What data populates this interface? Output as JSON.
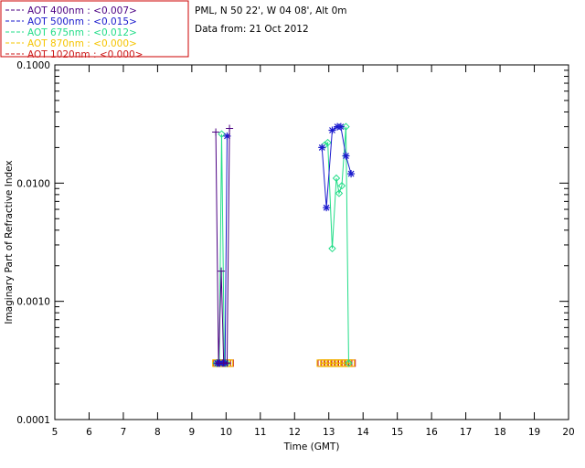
{
  "chart_data": {
    "type": "line",
    "site_label": "PML, N 50 22', W 04 08', Alt 0m",
    "date_label": "Data from: 21 Oct 2012",
    "xlabel": "Time (GMT)",
    "ylabel": "Imaginary Part of Refractive Index",
    "xlim": [
      5,
      20
    ],
    "ylim": [
      0.0001,
      0.1
    ],
    "yscale": "log",
    "x_ticks": [
      "5",
      "6",
      "7",
      "8",
      "9",
      "10",
      "11",
      "12",
      "13",
      "14",
      "15",
      "16",
      "17",
      "18",
      "19",
      "20"
    ],
    "y_ticks": [
      {
        "value": 0.0001,
        "label": "0.0001"
      },
      {
        "value": 0.001,
        "label": "0.0010"
      },
      {
        "value": 0.01,
        "label": "0.0100"
      },
      {
        "value": 0.1,
        "label": "0.1000"
      }
    ],
    "legend_position": "top-left",
    "series": [
      {
        "name": "AOT  400nm : <0.007>",
        "color": "#4b0082",
        "marker": "+",
        "x": [
          9.7,
          9.78,
          9.86,
          9.93,
          10.03,
          10.1
        ],
        "y": [
          0.027,
          0.0003,
          0.0018,
          0.0003,
          0.0003,
          0.029
        ]
      },
      {
        "name": "AOT  500nm : <0.015>",
        "color": "#1a1acd",
        "marker": "*",
        "x": [
          9.74,
          9.82,
          9.89,
          9.97,
          10.03,
          12.8,
          12.93,
          13.1,
          13.25,
          13.35,
          13.5,
          13.65
        ],
        "y": [
          0.0003,
          0.0003,
          0.0003,
          0.0003,
          0.025,
          0.02,
          0.0062,
          0.028,
          0.03,
          0.03,
          0.017,
          0.012
        ]
      },
      {
        "name": "AOT  675nm : <0.012>",
        "color": "#22dd88",
        "marker": "diamond",
        "x": [
          9.72,
          9.8,
          9.87,
          9.95,
          10.02,
          12.88,
          12.97,
          13.1,
          13.22,
          13.3,
          13.38,
          13.5,
          13.58
        ],
        "y": [
          0.0003,
          0.0003,
          0.026,
          0.0003,
          0.0003,
          0.021,
          0.022,
          0.0028,
          0.011,
          0.0082,
          0.0095,
          0.03,
          0.0003
        ]
      },
      {
        "name": "AOT  870nm : <0.000>",
        "color": "#f5c400",
        "marker": "square",
        "x": [
          9.7,
          9.78,
          9.86,
          9.94,
          10.02,
          10.1,
          12.75,
          12.85,
          12.95,
          13.05,
          13.15,
          13.25,
          13.35,
          13.45,
          13.55,
          13.65
        ],
        "y": [
          0.0003,
          0.0003,
          0.0003,
          0.0003,
          0.0003,
          0.0003,
          0.0003,
          0.0003,
          0.0003,
          0.0003,
          0.0003,
          0.0003,
          0.0003,
          0.0003,
          0.0003,
          0.0003
        ]
      },
      {
        "name": "AOT 1020nm : <0.000>",
        "color": "#cc1a1a",
        "marker": "square",
        "x": [
          9.72,
          9.8,
          9.88,
          9.96,
          10.04,
          10.12,
          12.78,
          12.88,
          12.98,
          13.08,
          13.18,
          13.28,
          13.38,
          13.48,
          13.58,
          13.68
        ],
        "y": [
          0.0003,
          0.0003,
          0.0003,
          0.0003,
          0.0003,
          0.0003,
          0.0003,
          0.0003,
          0.0003,
          0.0003,
          0.0003,
          0.0003,
          0.0003,
          0.0003,
          0.0003,
          0.0003
        ]
      }
    ]
  }
}
